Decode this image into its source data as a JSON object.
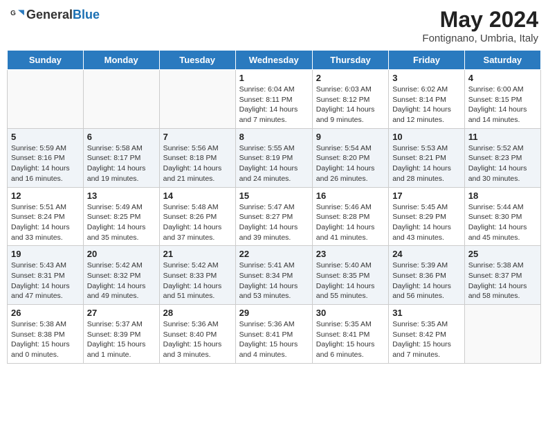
{
  "header": {
    "logo_general": "General",
    "logo_blue": "Blue",
    "title": "May 2024",
    "subtitle": "Fontignano, Umbria, Italy"
  },
  "weekdays": [
    "Sunday",
    "Monday",
    "Tuesday",
    "Wednesday",
    "Thursday",
    "Friday",
    "Saturday"
  ],
  "weeks": [
    [
      {
        "day": "",
        "info": ""
      },
      {
        "day": "",
        "info": ""
      },
      {
        "day": "",
        "info": ""
      },
      {
        "day": "1",
        "info": "Sunrise: 6:04 AM\nSunset: 8:11 PM\nDaylight: 14 hours\nand 7 minutes."
      },
      {
        "day": "2",
        "info": "Sunrise: 6:03 AM\nSunset: 8:12 PM\nDaylight: 14 hours\nand 9 minutes."
      },
      {
        "day": "3",
        "info": "Sunrise: 6:02 AM\nSunset: 8:14 PM\nDaylight: 14 hours\nand 12 minutes."
      },
      {
        "day": "4",
        "info": "Sunrise: 6:00 AM\nSunset: 8:15 PM\nDaylight: 14 hours\nand 14 minutes."
      }
    ],
    [
      {
        "day": "5",
        "info": "Sunrise: 5:59 AM\nSunset: 8:16 PM\nDaylight: 14 hours\nand 16 minutes."
      },
      {
        "day": "6",
        "info": "Sunrise: 5:58 AM\nSunset: 8:17 PM\nDaylight: 14 hours\nand 19 minutes."
      },
      {
        "day": "7",
        "info": "Sunrise: 5:56 AM\nSunset: 8:18 PM\nDaylight: 14 hours\nand 21 minutes."
      },
      {
        "day": "8",
        "info": "Sunrise: 5:55 AM\nSunset: 8:19 PM\nDaylight: 14 hours\nand 24 minutes."
      },
      {
        "day": "9",
        "info": "Sunrise: 5:54 AM\nSunset: 8:20 PM\nDaylight: 14 hours\nand 26 minutes."
      },
      {
        "day": "10",
        "info": "Sunrise: 5:53 AM\nSunset: 8:21 PM\nDaylight: 14 hours\nand 28 minutes."
      },
      {
        "day": "11",
        "info": "Sunrise: 5:52 AM\nSunset: 8:23 PM\nDaylight: 14 hours\nand 30 minutes."
      }
    ],
    [
      {
        "day": "12",
        "info": "Sunrise: 5:51 AM\nSunset: 8:24 PM\nDaylight: 14 hours\nand 33 minutes."
      },
      {
        "day": "13",
        "info": "Sunrise: 5:49 AM\nSunset: 8:25 PM\nDaylight: 14 hours\nand 35 minutes."
      },
      {
        "day": "14",
        "info": "Sunrise: 5:48 AM\nSunset: 8:26 PM\nDaylight: 14 hours\nand 37 minutes."
      },
      {
        "day": "15",
        "info": "Sunrise: 5:47 AM\nSunset: 8:27 PM\nDaylight: 14 hours\nand 39 minutes."
      },
      {
        "day": "16",
        "info": "Sunrise: 5:46 AM\nSunset: 8:28 PM\nDaylight: 14 hours\nand 41 minutes."
      },
      {
        "day": "17",
        "info": "Sunrise: 5:45 AM\nSunset: 8:29 PM\nDaylight: 14 hours\nand 43 minutes."
      },
      {
        "day": "18",
        "info": "Sunrise: 5:44 AM\nSunset: 8:30 PM\nDaylight: 14 hours\nand 45 minutes."
      }
    ],
    [
      {
        "day": "19",
        "info": "Sunrise: 5:43 AM\nSunset: 8:31 PM\nDaylight: 14 hours\nand 47 minutes."
      },
      {
        "day": "20",
        "info": "Sunrise: 5:42 AM\nSunset: 8:32 PM\nDaylight: 14 hours\nand 49 minutes."
      },
      {
        "day": "21",
        "info": "Sunrise: 5:42 AM\nSunset: 8:33 PM\nDaylight: 14 hours\nand 51 minutes."
      },
      {
        "day": "22",
        "info": "Sunrise: 5:41 AM\nSunset: 8:34 PM\nDaylight: 14 hours\nand 53 minutes."
      },
      {
        "day": "23",
        "info": "Sunrise: 5:40 AM\nSunset: 8:35 PM\nDaylight: 14 hours\nand 55 minutes."
      },
      {
        "day": "24",
        "info": "Sunrise: 5:39 AM\nSunset: 8:36 PM\nDaylight: 14 hours\nand 56 minutes."
      },
      {
        "day": "25",
        "info": "Sunrise: 5:38 AM\nSunset: 8:37 PM\nDaylight: 14 hours\nand 58 minutes."
      }
    ],
    [
      {
        "day": "26",
        "info": "Sunrise: 5:38 AM\nSunset: 8:38 PM\nDaylight: 15 hours\nand 0 minutes."
      },
      {
        "day": "27",
        "info": "Sunrise: 5:37 AM\nSunset: 8:39 PM\nDaylight: 15 hours\nand 1 minute."
      },
      {
        "day": "28",
        "info": "Sunrise: 5:36 AM\nSunset: 8:40 PM\nDaylight: 15 hours\nand 3 minutes."
      },
      {
        "day": "29",
        "info": "Sunrise: 5:36 AM\nSunset: 8:41 PM\nDaylight: 15 hours\nand 4 minutes."
      },
      {
        "day": "30",
        "info": "Sunrise: 5:35 AM\nSunset: 8:41 PM\nDaylight: 15 hours\nand 6 minutes."
      },
      {
        "day": "31",
        "info": "Sunrise: 5:35 AM\nSunset: 8:42 PM\nDaylight: 15 hours\nand 7 minutes."
      },
      {
        "day": "",
        "info": ""
      }
    ]
  ]
}
